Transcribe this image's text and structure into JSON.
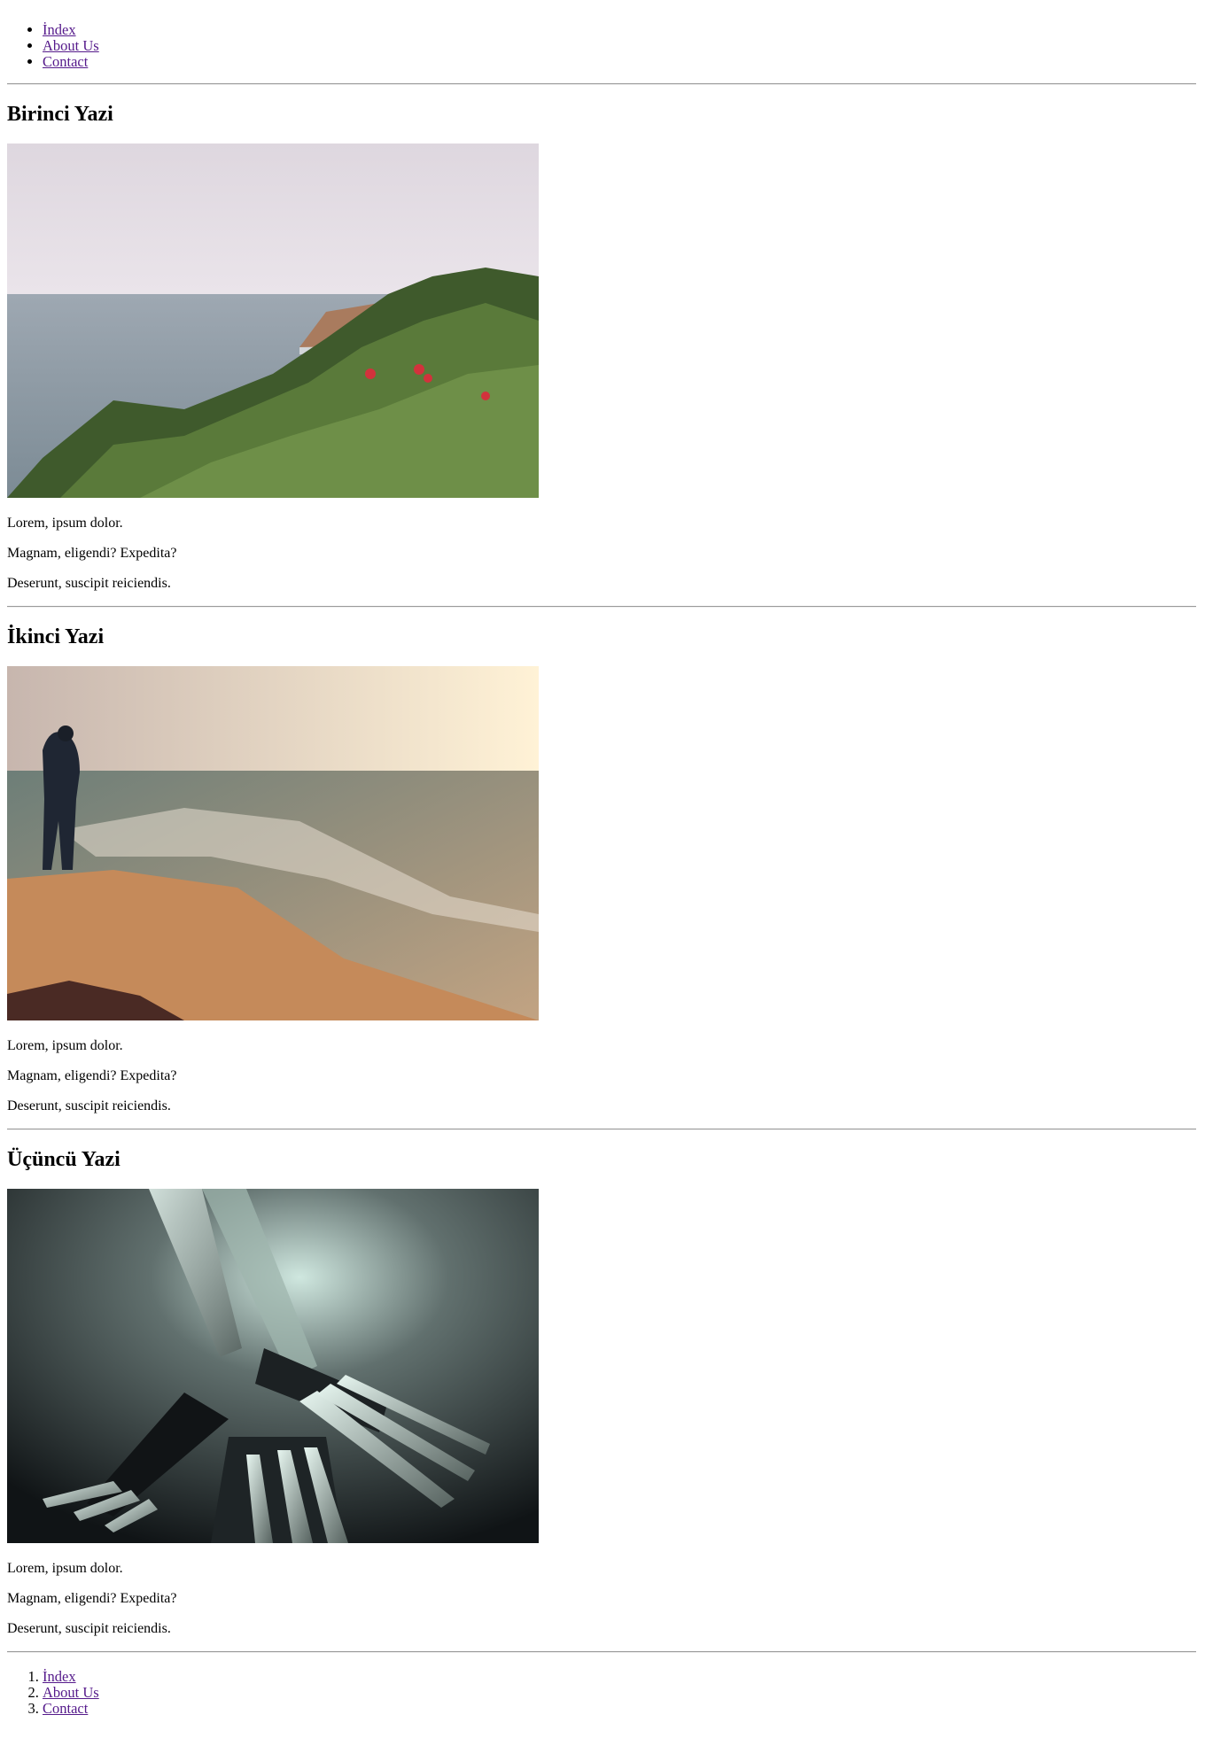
{
  "nav": {
    "items": [
      {
        "label": "İndex"
      },
      {
        "label": "About Us"
      },
      {
        "label": "Contact"
      }
    ]
  },
  "posts": [
    {
      "title": "Birinci Yazi",
      "paragraphs": [
        "Lorem, ipsum dolor.",
        "Magnam, eligendi? Expedita?",
        "Deserunt, suscipit reiciendis."
      ]
    },
    {
      "title": "İkinci Yazi",
      "paragraphs": [
        "Lorem, ipsum dolor.",
        "Magnam, eligendi? Expedita?",
        "Deserunt, suscipit reiciendis."
      ]
    },
    {
      "title": "Üçüncü Yazi",
      "paragraphs": [
        "Lorem, ipsum dolor.",
        "Magnam, eligendi? Expedita?",
        "Deserunt, suscipit reiciendis."
      ]
    }
  ],
  "footer_nav": {
    "items": [
      {
        "label": "İndex"
      },
      {
        "label": "About Us"
      },
      {
        "label": "Contact"
      }
    ]
  },
  "colors": {
    "link": "#551a8b",
    "rule": "#9a9a9a"
  }
}
